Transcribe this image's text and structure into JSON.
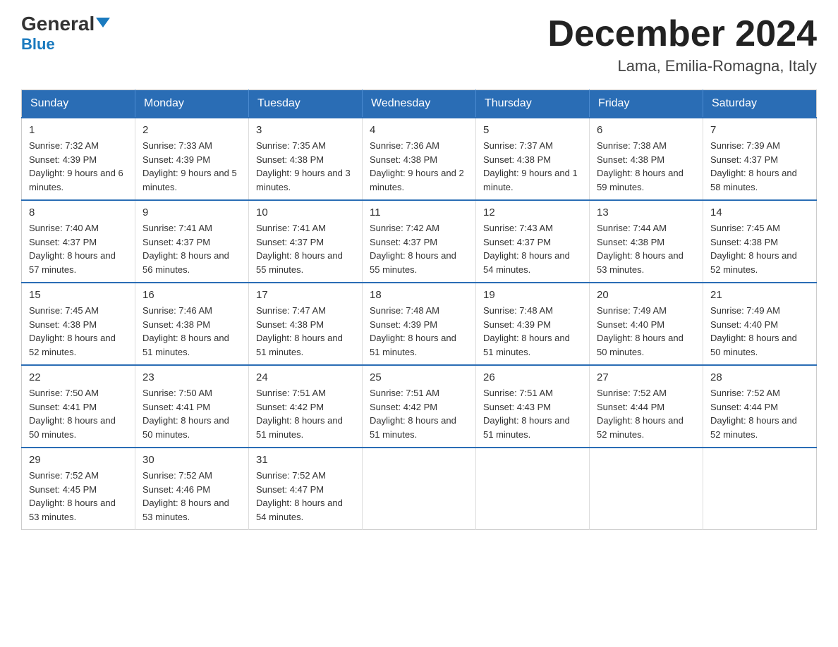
{
  "logo": {
    "general": "General",
    "blue": "Blue"
  },
  "title": "December 2024",
  "subtitle": "Lama, Emilia-Romagna, Italy",
  "weekdays": [
    "Sunday",
    "Monday",
    "Tuesday",
    "Wednesday",
    "Thursday",
    "Friday",
    "Saturday"
  ],
  "weeks": [
    [
      {
        "day": "1",
        "sunrise": "7:32 AM",
        "sunset": "4:39 PM",
        "daylight": "9 hours and 6 minutes."
      },
      {
        "day": "2",
        "sunrise": "7:33 AM",
        "sunset": "4:39 PM",
        "daylight": "9 hours and 5 minutes."
      },
      {
        "day": "3",
        "sunrise": "7:35 AM",
        "sunset": "4:38 PM",
        "daylight": "9 hours and 3 minutes."
      },
      {
        "day": "4",
        "sunrise": "7:36 AM",
        "sunset": "4:38 PM",
        "daylight": "9 hours and 2 minutes."
      },
      {
        "day": "5",
        "sunrise": "7:37 AM",
        "sunset": "4:38 PM",
        "daylight": "9 hours and 1 minute."
      },
      {
        "day": "6",
        "sunrise": "7:38 AM",
        "sunset": "4:38 PM",
        "daylight": "8 hours and 59 minutes."
      },
      {
        "day": "7",
        "sunrise": "7:39 AM",
        "sunset": "4:37 PM",
        "daylight": "8 hours and 58 minutes."
      }
    ],
    [
      {
        "day": "8",
        "sunrise": "7:40 AM",
        "sunset": "4:37 PM",
        "daylight": "8 hours and 57 minutes."
      },
      {
        "day": "9",
        "sunrise": "7:41 AM",
        "sunset": "4:37 PM",
        "daylight": "8 hours and 56 minutes."
      },
      {
        "day": "10",
        "sunrise": "7:41 AM",
        "sunset": "4:37 PM",
        "daylight": "8 hours and 55 minutes."
      },
      {
        "day": "11",
        "sunrise": "7:42 AM",
        "sunset": "4:37 PM",
        "daylight": "8 hours and 55 minutes."
      },
      {
        "day": "12",
        "sunrise": "7:43 AM",
        "sunset": "4:37 PM",
        "daylight": "8 hours and 54 minutes."
      },
      {
        "day": "13",
        "sunrise": "7:44 AM",
        "sunset": "4:38 PM",
        "daylight": "8 hours and 53 minutes."
      },
      {
        "day": "14",
        "sunrise": "7:45 AM",
        "sunset": "4:38 PM",
        "daylight": "8 hours and 52 minutes."
      }
    ],
    [
      {
        "day": "15",
        "sunrise": "7:45 AM",
        "sunset": "4:38 PM",
        "daylight": "8 hours and 52 minutes."
      },
      {
        "day": "16",
        "sunrise": "7:46 AM",
        "sunset": "4:38 PM",
        "daylight": "8 hours and 51 minutes."
      },
      {
        "day": "17",
        "sunrise": "7:47 AM",
        "sunset": "4:38 PM",
        "daylight": "8 hours and 51 minutes."
      },
      {
        "day": "18",
        "sunrise": "7:48 AM",
        "sunset": "4:39 PM",
        "daylight": "8 hours and 51 minutes."
      },
      {
        "day": "19",
        "sunrise": "7:48 AM",
        "sunset": "4:39 PM",
        "daylight": "8 hours and 51 minutes."
      },
      {
        "day": "20",
        "sunrise": "7:49 AM",
        "sunset": "4:40 PM",
        "daylight": "8 hours and 50 minutes."
      },
      {
        "day": "21",
        "sunrise": "7:49 AM",
        "sunset": "4:40 PM",
        "daylight": "8 hours and 50 minutes."
      }
    ],
    [
      {
        "day": "22",
        "sunrise": "7:50 AM",
        "sunset": "4:41 PM",
        "daylight": "8 hours and 50 minutes."
      },
      {
        "day": "23",
        "sunrise": "7:50 AM",
        "sunset": "4:41 PM",
        "daylight": "8 hours and 50 minutes."
      },
      {
        "day": "24",
        "sunrise": "7:51 AM",
        "sunset": "4:42 PM",
        "daylight": "8 hours and 51 minutes."
      },
      {
        "day": "25",
        "sunrise": "7:51 AM",
        "sunset": "4:42 PM",
        "daylight": "8 hours and 51 minutes."
      },
      {
        "day": "26",
        "sunrise": "7:51 AM",
        "sunset": "4:43 PM",
        "daylight": "8 hours and 51 minutes."
      },
      {
        "day": "27",
        "sunrise": "7:52 AM",
        "sunset": "4:44 PM",
        "daylight": "8 hours and 52 minutes."
      },
      {
        "day": "28",
        "sunrise": "7:52 AM",
        "sunset": "4:44 PM",
        "daylight": "8 hours and 52 minutes."
      }
    ],
    [
      {
        "day": "29",
        "sunrise": "7:52 AM",
        "sunset": "4:45 PM",
        "daylight": "8 hours and 53 minutes."
      },
      {
        "day": "30",
        "sunrise": "7:52 AM",
        "sunset": "4:46 PM",
        "daylight": "8 hours and 53 minutes."
      },
      {
        "day": "31",
        "sunrise": "7:52 AM",
        "sunset": "4:47 PM",
        "daylight": "8 hours and 54 minutes."
      },
      null,
      null,
      null,
      null
    ]
  ]
}
